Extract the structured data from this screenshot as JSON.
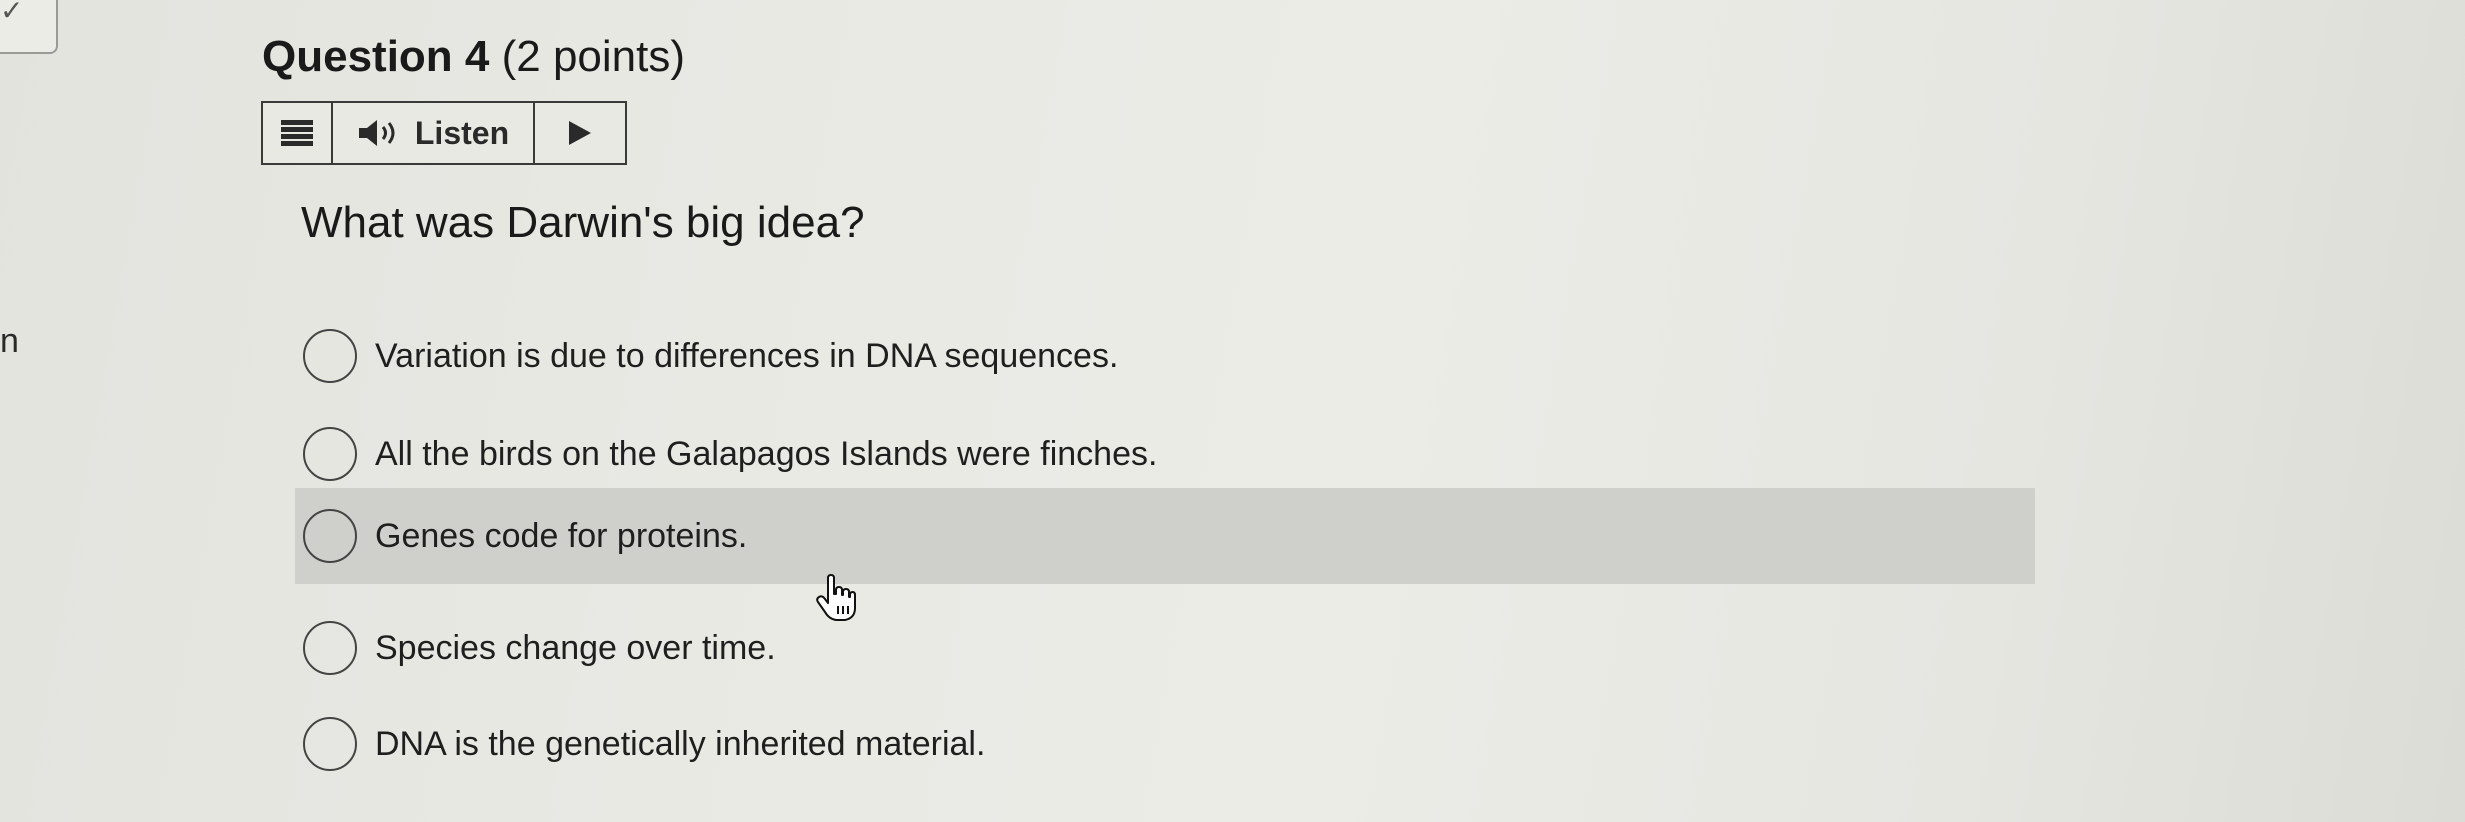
{
  "question": {
    "number_label": "Question 4",
    "points_label": "(2 points)",
    "text": "What was Darwin's big idea?"
  },
  "listen_toolbar": {
    "menu_icon": "hamburger-menu-icon",
    "speaker_icon": "speaker-icon",
    "listen_label": "Listen",
    "play_icon": "play-icon"
  },
  "options": [
    {
      "label": "Variation is due to differences in DNA sequences.",
      "selected": false,
      "hovered": false
    },
    {
      "label": "All the birds on the Galapagos Islands were finches.",
      "selected": false,
      "hovered": false
    },
    {
      "label": "Genes code for proteins.",
      "selected": false,
      "hovered": true
    },
    {
      "label": "Species change over time.",
      "selected": false,
      "hovered": false
    },
    {
      "label": "DNA is the genetically inherited material.",
      "selected": false,
      "hovered": false
    }
  ],
  "edge": {
    "letter": "n",
    "check_icon": "checkmark-icon"
  },
  "colors": {
    "background": "#e9e9e4",
    "hover_row": "#cfcfcb",
    "text": "#1f1f1f",
    "border": "#3a3a3a"
  }
}
